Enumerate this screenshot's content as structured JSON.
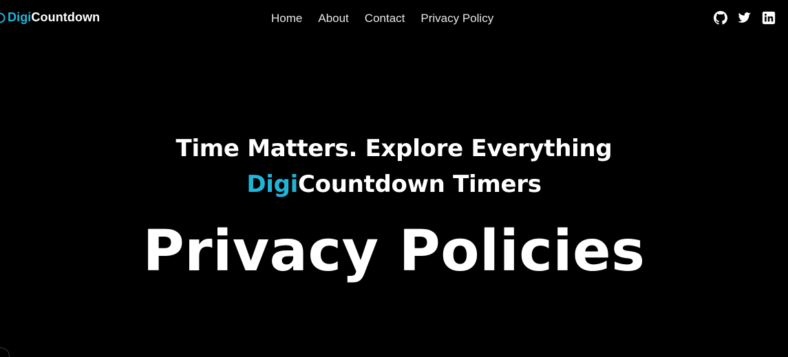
{
  "header": {
    "brand": {
      "accent": "Digi",
      "rest": "Countdown"
    },
    "nav": [
      {
        "label": "Home"
      },
      {
        "label": "About"
      },
      {
        "label": "Contact"
      },
      {
        "label": "Privacy Policy"
      }
    ],
    "social": [
      {
        "icon": "github-icon"
      },
      {
        "icon": "twitter-icon"
      },
      {
        "icon": "linkedin-icon"
      }
    ]
  },
  "hero": {
    "tagline_line1": "Time Matters. Explore Everything",
    "tagline_accent": "Digi",
    "tagline_rest": "Countdown Timers",
    "title": "Privacy Policies"
  },
  "colors": {
    "background": "#000000",
    "accent": "#1fb5d9",
    "text": "#ffffff"
  }
}
